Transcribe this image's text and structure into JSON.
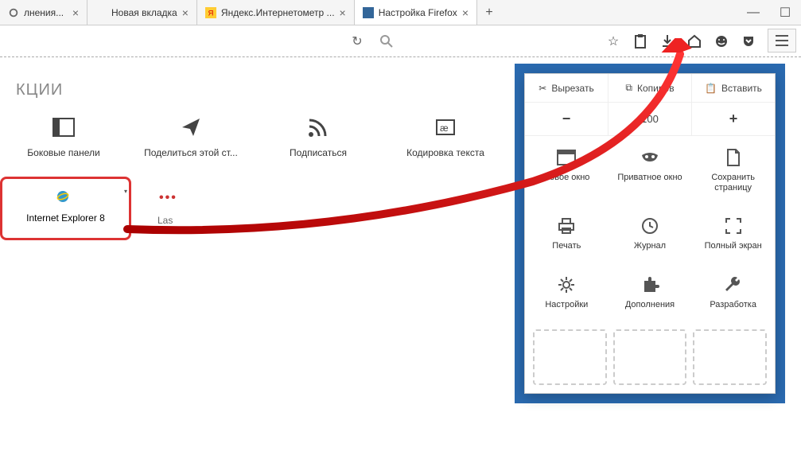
{
  "tabs": [
    {
      "label": "лнения...",
      "favicon": "gear"
    },
    {
      "label": "Новая вкладка",
      "favicon": ""
    },
    {
      "label": "Яндекс.Интернетометр ...",
      "favicon": "yandex"
    },
    {
      "label": "Настройка Firefox",
      "favicon": "firefox",
      "active": true
    }
  ],
  "newtab": "+",
  "section_title": "КЦИИ",
  "customize_items": [
    {
      "label": "Боковые панели",
      "icon": "sidebar"
    },
    {
      "label": "Поделиться этой ст...",
      "icon": "share"
    },
    {
      "label": "Подписаться",
      "icon": "rss"
    },
    {
      "label": "Кодировка текста",
      "icon": "encoding"
    }
  ],
  "ie_item": {
    "label": "Internet Explorer 8"
  },
  "truncated_item": "Las",
  "toolbar_icons": [
    "star",
    "clipboard",
    "download",
    "home",
    "smile",
    "pocket"
  ],
  "panel": {
    "cut": "Вырезать",
    "copy": "Копиров",
    "paste": "Вставить",
    "zoom_out": "−",
    "zoom_value": "100",
    "zoom_in": "+",
    "items": [
      {
        "label": "Новое окно",
        "icon": "window"
      },
      {
        "label": "Приватное окно",
        "icon": "mask"
      },
      {
        "label": "Сохранить страницу",
        "icon": "file"
      },
      {
        "label": "Печать",
        "icon": "print"
      },
      {
        "label": "Журнал",
        "icon": "history"
      },
      {
        "label": "Полный экран",
        "icon": "fullscreen"
      },
      {
        "label": "Настройки",
        "icon": "gear"
      },
      {
        "label": "Дополнения",
        "icon": "puzzle"
      },
      {
        "label": "Разработка",
        "icon": "wrench"
      }
    ]
  }
}
